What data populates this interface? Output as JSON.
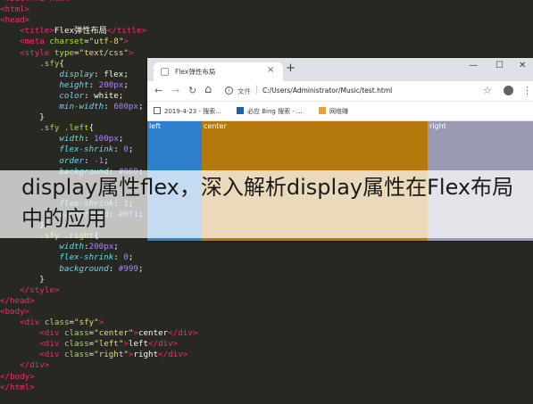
{
  "code": {
    "lines": [
      [
        {
          "c": "tag",
          "t": "<!DOCTYPE html>"
        }
      ],
      [
        {
          "c": "tag",
          "t": "<html>"
        }
      ],
      [
        {
          "c": "tag",
          "t": "<head>"
        }
      ],
      [
        {
          "c": "plain",
          "t": "    "
        },
        {
          "c": "tag",
          "t": "<title>"
        },
        {
          "c": "plain",
          "t": "Flex弹性布局"
        },
        {
          "c": "tag",
          "t": "</title>"
        }
      ],
      [
        {
          "c": "plain",
          "t": "    "
        },
        {
          "c": "tag",
          "t": "<meta "
        },
        {
          "c": "attr",
          "t": "charset"
        },
        {
          "c": "plain",
          "t": "="
        },
        {
          "c": "str",
          "t": "\"utf-8\""
        },
        {
          "c": "tag",
          "t": ">"
        }
      ],
      [
        {
          "c": "plain",
          "t": "    "
        },
        {
          "c": "tag",
          "t": "<style "
        },
        {
          "c": "attr",
          "t": "type"
        },
        {
          "c": "plain",
          "t": "="
        },
        {
          "c": "str",
          "t": "\"text/css\""
        },
        {
          "c": "tag",
          "t": ">"
        }
      ],
      [
        {
          "c": "plain",
          "t": "        "
        },
        {
          "c": "sel",
          "t": ".sfy"
        },
        {
          "c": "plain",
          "t": "{"
        }
      ],
      [
        {
          "c": "plain",
          "t": "            "
        },
        {
          "c": "prop",
          "t": "display"
        },
        {
          "c": "plain",
          "t": ": flex;"
        }
      ],
      [
        {
          "c": "plain",
          "t": "            "
        },
        {
          "c": "prop",
          "t": "height"
        },
        {
          "c": "plain",
          "t": ": "
        },
        {
          "c": "num",
          "t": "200px"
        },
        {
          "c": "plain",
          "t": ";"
        }
      ],
      [
        {
          "c": "plain",
          "t": "            "
        },
        {
          "c": "prop",
          "t": "color"
        },
        {
          "c": "plain",
          "t": ": white;"
        }
      ],
      [
        {
          "c": "plain",
          "t": "            "
        },
        {
          "c": "prop",
          "t": "min-width"
        },
        {
          "c": "plain",
          "t": ": "
        },
        {
          "c": "num",
          "t": "600px"
        },
        {
          "c": "plain",
          "t": ";"
        }
      ],
      [
        {
          "c": "plain",
          "t": "        }"
        }
      ],
      [
        {
          "c": "plain",
          "t": "        "
        },
        {
          "c": "sel",
          "t": ".sfy .left"
        },
        {
          "c": "plain",
          "t": "{"
        }
      ],
      [
        {
          "c": "plain",
          "t": "            "
        },
        {
          "c": "prop",
          "t": "width"
        },
        {
          "c": "plain",
          "t": ": "
        },
        {
          "c": "num",
          "t": "100px"
        },
        {
          "c": "plain",
          "t": ";"
        }
      ],
      [
        {
          "c": "plain",
          "t": "            "
        },
        {
          "c": "prop",
          "t": "flex-shrink"
        },
        {
          "c": "plain",
          "t": ": "
        },
        {
          "c": "num",
          "t": "0"
        },
        {
          "c": "plain",
          "t": ";"
        }
      ],
      [
        {
          "c": "plain",
          "t": "            "
        },
        {
          "c": "prop",
          "t": "order"
        },
        {
          "c": "plain",
          "t": ": "
        },
        {
          "c": "num",
          "t": "-1"
        },
        {
          "c": "plain",
          "t": ";"
        }
      ],
      [
        {
          "c": "plain",
          "t": "            "
        },
        {
          "c": "prop",
          "t": "background"
        },
        {
          "c": "plain",
          "t": ": "
        },
        {
          "c": "num",
          "t": "#069"
        },
        {
          "c": "plain",
          "t": ";"
        }
      ],
      [
        {
          "c": "plain",
          "t": ""
        }
      ],
      [
        {
          "c": "plain",
          "t": ""
        }
      ],
      [
        {
          "c": "plain",
          "t": "            "
        },
        {
          "c": "prop",
          "t": "flex-shrink"
        },
        {
          "c": "plain",
          "t": ": "
        },
        {
          "c": "num",
          "t": "1"
        },
        {
          "c": "plain",
          "t": ";"
        }
      ],
      [
        {
          "c": "plain",
          "t": "            "
        },
        {
          "c": "prop",
          "t": "background"
        },
        {
          "c": "plain",
          "t": ": "
        },
        {
          "c": "num",
          "t": "#0f1"
        },
        {
          "c": "plain",
          "t": ";"
        }
      ],
      [
        {
          "c": "plain",
          "t": "        }"
        }
      ],
      [
        {
          "c": "plain",
          "t": "        "
        },
        {
          "c": "sel",
          "t": ".sfy .right"
        },
        {
          "c": "plain",
          "t": "{"
        }
      ],
      [
        {
          "c": "plain",
          "t": "            "
        },
        {
          "c": "prop",
          "t": "width"
        },
        {
          "c": "plain",
          "t": ":"
        },
        {
          "c": "num",
          "t": "200px"
        },
        {
          "c": "plain",
          "t": ";"
        }
      ],
      [
        {
          "c": "plain",
          "t": "            "
        },
        {
          "c": "prop",
          "t": "flex-shrink"
        },
        {
          "c": "plain",
          "t": ": "
        },
        {
          "c": "num",
          "t": "0"
        },
        {
          "c": "plain",
          "t": ";"
        }
      ],
      [
        {
          "c": "plain",
          "t": "            "
        },
        {
          "c": "prop",
          "t": "background"
        },
        {
          "c": "plain",
          "t": ": "
        },
        {
          "c": "num",
          "t": "#999"
        },
        {
          "c": "plain",
          "t": ";"
        }
      ],
      [
        {
          "c": "plain",
          "t": "        }"
        }
      ],
      [
        {
          "c": "plain",
          "t": "    "
        },
        {
          "c": "tag",
          "t": "</style>"
        }
      ],
      [
        {
          "c": "tag",
          "t": "</head>"
        }
      ],
      [
        {
          "c": "tag",
          "t": "<body>"
        }
      ],
      [
        {
          "c": "plain",
          "t": "    "
        },
        {
          "c": "tag",
          "t": "<div "
        },
        {
          "c": "attr",
          "t": "class"
        },
        {
          "c": "plain",
          "t": "="
        },
        {
          "c": "str",
          "t": "\"sfy\""
        },
        {
          "c": "tag",
          "t": ">"
        }
      ],
      [
        {
          "c": "plain",
          "t": "        "
        },
        {
          "c": "tag",
          "t": "<div "
        },
        {
          "c": "attr",
          "t": "class"
        },
        {
          "c": "plain",
          "t": "="
        },
        {
          "c": "str",
          "t": "\"center\""
        },
        {
          "c": "tag",
          "t": ">"
        },
        {
          "c": "plain",
          "t": "center"
        },
        {
          "c": "tag",
          "t": "</div>"
        }
      ],
      [
        {
          "c": "plain",
          "t": "        "
        },
        {
          "c": "tag",
          "t": "<div "
        },
        {
          "c": "attr",
          "t": "class"
        },
        {
          "c": "plain",
          "t": "="
        },
        {
          "c": "str",
          "t": "\"left\""
        },
        {
          "c": "tag",
          "t": ">"
        },
        {
          "c": "plain",
          "t": "left"
        },
        {
          "c": "tag",
          "t": "</div>"
        }
      ],
      [
        {
          "c": "plain",
          "t": "        "
        },
        {
          "c": "tag",
          "t": "<div "
        },
        {
          "c": "attr",
          "t": "class"
        },
        {
          "c": "plain",
          "t": "="
        },
        {
          "c": "str",
          "t": "\"right\""
        },
        {
          "c": "tag",
          "t": ">"
        },
        {
          "c": "plain",
          "t": "right"
        },
        {
          "c": "tag",
          "t": "</div>"
        }
      ],
      [
        {
          "c": "plain",
          "t": "    "
        },
        {
          "c": "tag",
          "t": "</div>"
        }
      ],
      [
        {
          "c": "tag",
          "t": "</body>"
        }
      ],
      [
        {
          "c": "tag",
          "t": "</html>"
        }
      ]
    ]
  },
  "browser": {
    "tab_title": "Flex弹性布局",
    "tab_close": "×",
    "new_tab": "+",
    "minimize": "—",
    "maximize": "☐",
    "close": "✕",
    "back": "←",
    "forward": "→",
    "reload": "↻",
    "home": "⌂",
    "info": "i",
    "file_label": "文件",
    "url_separator": "|",
    "url": "C:/Users/Administrator/Music/test.html",
    "star": "☆",
    "menu": "⋮",
    "bookmarks": [
      {
        "label": "2019-4-23 - 搜索...",
        "icon_color": "#5f6368"
      },
      {
        "label": "必应 Bing 搜索 - ...",
        "icon_color": "#1e5fa8"
      },
      {
        "label": "网络赚",
        "icon_color": "#e8a23a"
      }
    ],
    "boxes": {
      "left": "left",
      "center": "center",
      "right": "right"
    }
  },
  "overlay": {
    "title": "display属性flex，深入解析display属性在Flex布局中的应用"
  }
}
